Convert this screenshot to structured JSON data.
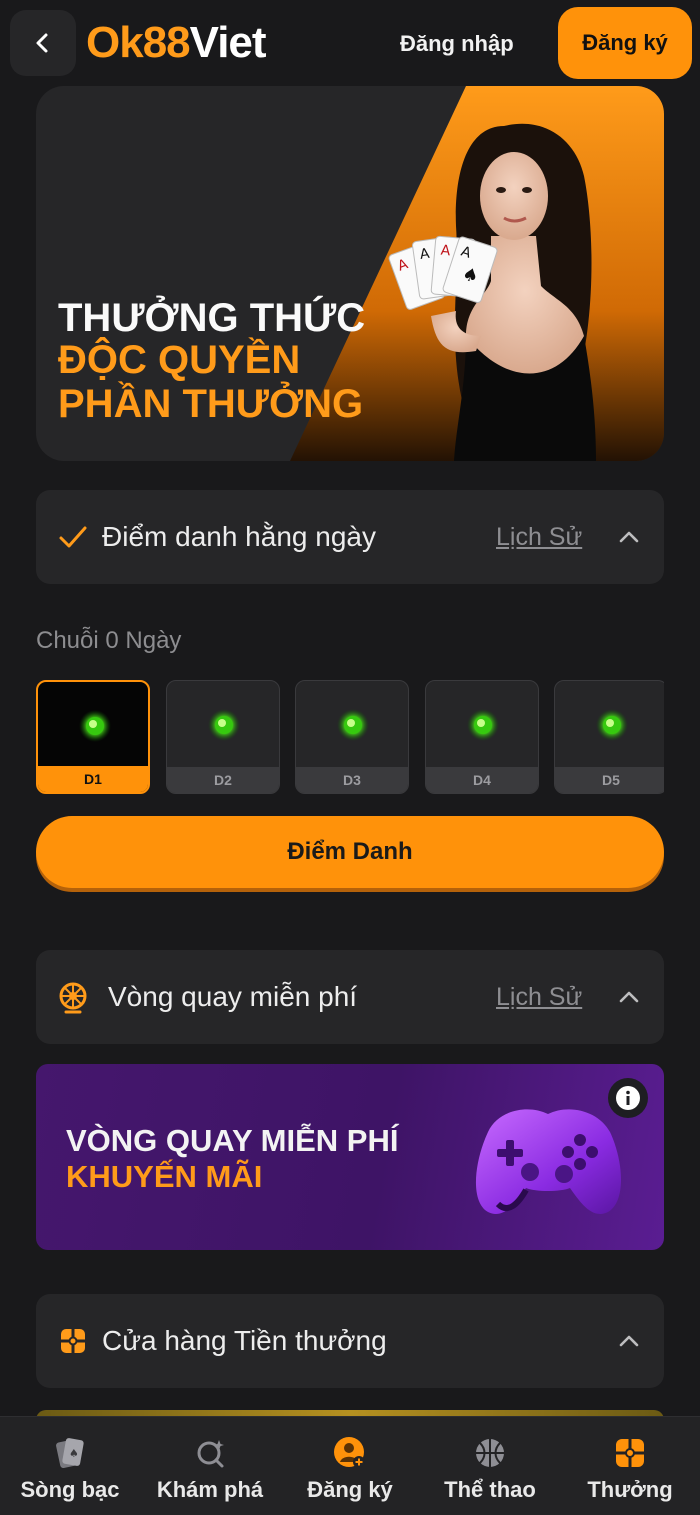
{
  "header": {
    "logo_part1": "Ok88",
    "logo_part2": "Viet",
    "login_label": "Đăng nhập",
    "register_label": "Đăng ký"
  },
  "hero": {
    "line1": "THƯỞNG THỨC",
    "line2": "ĐỘC QUYỀN",
    "line3": "PHẦN THƯỞNG"
  },
  "daily_checkin": {
    "title": "Điểm danh hằng ngày",
    "history_label": "Lịch Sử",
    "streak_label": "Chuỗi 0 Ngày",
    "days": [
      {
        "label": "D1",
        "active": true
      },
      {
        "label": "D2",
        "active": false
      },
      {
        "label": "D3",
        "active": false
      },
      {
        "label": "D4",
        "active": false
      },
      {
        "label": "D5",
        "active": false
      }
    ],
    "button_label": "Điểm Danh"
  },
  "free_spin": {
    "title": "Vòng quay miễn phí",
    "history_label": "Lịch Sử",
    "promo_line1": "VÒNG QUAY MIỄN PHÍ",
    "promo_line2": "KHUYẾN MÃI"
  },
  "bonus_store": {
    "title": "Cửa hàng Tiền thưởng"
  },
  "bottom_nav": [
    {
      "label": "Sòng bạc",
      "icon": "cards-icon"
    },
    {
      "label": "Khám phá",
      "icon": "explore-icon"
    },
    {
      "label": "Đăng ký",
      "icon": "user-add-icon"
    },
    {
      "label": "Thể thao",
      "icon": "basketball-icon"
    },
    {
      "label": "Thưởng",
      "icon": "gift-icon"
    }
  ],
  "colors": {
    "accent": "#ff920a",
    "background": "#19191b",
    "card": "#262628",
    "promo_purple": "#45176d"
  }
}
